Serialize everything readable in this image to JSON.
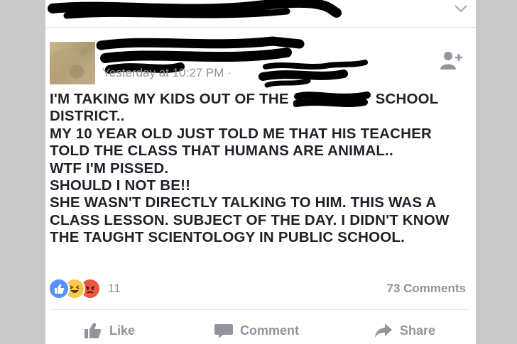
{
  "post": {
    "timestamp": "Yesterday at 10:27 PM ·",
    "lines": [
      "I'M TAKING MY KIDS OUT OF THE",
      "SCHOOL",
      "DISTRICT..",
      "MY 10 YEAR OLD JUST TOLD ME THAT HIS TEACHER",
      "TOLD THE CLASS THAT HUMANS ARE ANIMAL..",
      "WTF I'M PISSED.",
      "SHOULD I NOT BE!!",
      "SHE WASN'T DIRECTLY TALKING TO HIM. THIS WAS A",
      "CLASS LESSON. SUBJECT OF THE DAY. I DIDN'T KNOW",
      "THE TAUGHT SCIENTOLOGY IN PUBLIC SCHOOL."
    ]
  },
  "stats": {
    "reaction_count": "11",
    "comments": "73 Comments"
  },
  "actions": {
    "like": "Like",
    "comment": "Comment",
    "share": "Share"
  },
  "icons": {
    "reactions": [
      "like-reaction-icon",
      "haha-reaction-icon",
      "angry-reaction-icon"
    ],
    "add_friend": "add-friend-icon",
    "chevron": "chevron-down-icon"
  },
  "colors": {
    "background": "#c9c9c9",
    "card": "#ffffff",
    "text": "#1d2129",
    "muted": "#90949c",
    "like_blue": "#5890ff",
    "haha_yellow": "#f7c84b",
    "angry_red": "#e9573f"
  }
}
